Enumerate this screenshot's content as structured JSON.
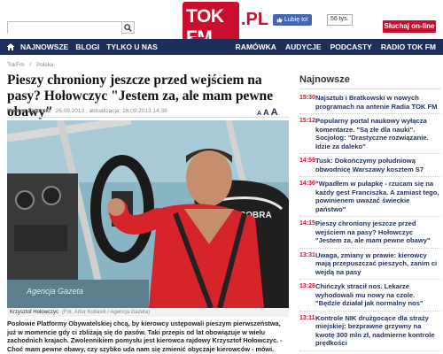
{
  "header": {
    "search_placeholder": "",
    "logo_text": "TOK FM",
    "logo_suffix": ".PL",
    "fb_like_label": "Lubię to!",
    "fb_like_count": "56 tys.",
    "listen_button": "Słuchaj on-line"
  },
  "nav": {
    "left": [
      "NAJNOWSZE",
      "BLOGI",
      "TYLKO U NAS"
    ],
    "right": [
      "RAMÓWKA",
      "AUDYCJE",
      "PODCASTY",
      "RADIO TOK FM"
    ]
  },
  "breadcrumb": [
    "TokFm",
    "/",
    "Polska"
  ],
  "article": {
    "headline": "Pieszy chroniony jeszcze przed wejściem na pasy? Hołowczyc \"Jestem za, ale mam pewne obawy\"",
    "author": "Kosma Zatorski",
    "dates": "26.09.2013 , aktualizacja: 26.09.2013 14:38",
    "font_sizes": [
      "A",
      "A",
      "A"
    ],
    "photo_watermark": "Agencja Gazeta",
    "caption": "Krzysztof Hołowczyc",
    "caption_source": "(Fot. Artur Kubasik / Agencja Gazeta)",
    "lead": "Posłowie Platformy Obywatelskiej chcą, by kierowcy ustępowali pieszym pierwszeństwa, już w momencie gdy ci zbliżają się do pasów. Taki przepis od lat obowiązuje w wielu zachodnich krajach. Zwolennikiem pomysłu jest kierowca rajdowy Krzysztof Hołowczyc. - Choć mam pewne obawy, czy szybko uda nam się zmienić obyczaje kierowców - mówi."
  },
  "sidebar": {
    "title": "Najnowsze",
    "items": [
      {
        "time": "15:30",
        "text": "Najsztub i Bratkowski w nowych programach na antenie Radia TOK FM"
      },
      {
        "time": "15:12",
        "text": "Popularny portal naukowy wyłącza komentarze. \"Są złe dla nauki\". Socjolog: \"Drastyczne rozwiązanie. Idzie za daleko\""
      },
      {
        "time": "14:59",
        "text": "Tusk: Dokończymy południową obwodnicę Warszawy kosztem S7"
      },
      {
        "time": "14:36",
        "text": "\"Wpadłem w pułapkę - rzucam się na każdy gest Franciszka. A zamiast tego, powinienem uważać świeckie państwo\""
      },
      {
        "time": "14:15",
        "text": "Pieszy chroniony jeszcze przed wejściem na pasy? Hołowczyc \"Jestem za, ale mam pewne obawy\""
      },
      {
        "time": "13:31",
        "text": "Uwaga, zmiany w prawie: kierowcy mają przepuszczać pieszych, zanim ci wejdą na pasy"
      },
      {
        "time": "13:28",
        "text": "Chińczyk stracił nos. Lekarze wyhodowali mu nowy na czole. \"Będzie działał jak normalny nos\""
      },
      {
        "time": "13:11",
        "text": "Kontrole NIK drużgocące dla straży miejskiej: bezprawne grzywny na kwotę 300 mln zł, nadmierne kontrole prędkości"
      }
    ]
  },
  "colors": {
    "brand_red": "#c8102e",
    "nav_blue": "#1c2f5b"
  }
}
